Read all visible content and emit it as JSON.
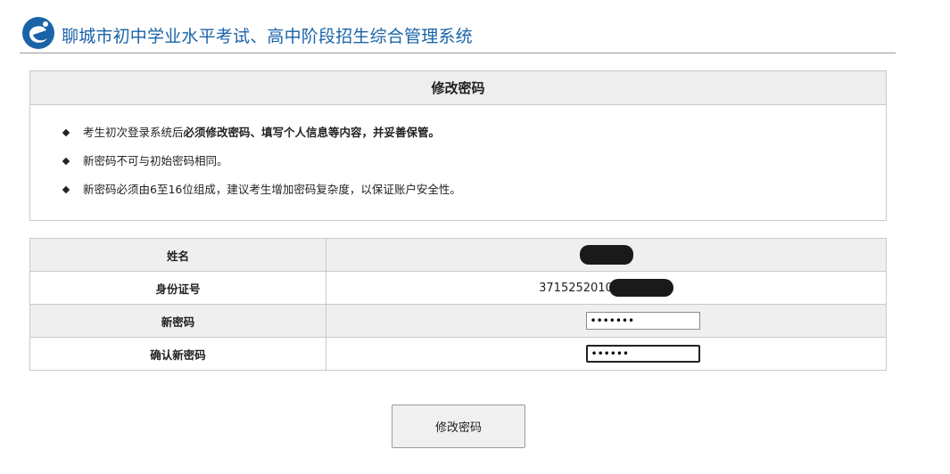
{
  "header": {
    "title": "聊城市初中学业水平考试、高中阶段招生综合管理系统",
    "logo_icon": "e-logo-icon",
    "accent_color": "#1a63a8"
  },
  "notice": {
    "heading": "修改密码",
    "items": [
      {
        "normal": "考生初次登录系统后",
        "bold": "必须修改密码、填写个人信息等内容，并妥善保管。"
      },
      {
        "normal": "新密码不可与初始密码相同。",
        "bold": ""
      },
      {
        "normal": "新密码必须由6至16位组成，建议考生增加密码复杂度，以保证账户安全性。",
        "bold": ""
      }
    ]
  },
  "form": {
    "name_label": "姓名",
    "id_label": "身份证号",
    "id_value_visible": "3715252010",
    "new_password_label": "新密码",
    "new_password_value": "•••••••",
    "confirm_password_label": "确认新密码",
    "confirm_password_value": "••••••"
  },
  "submit_label": "修改密码"
}
